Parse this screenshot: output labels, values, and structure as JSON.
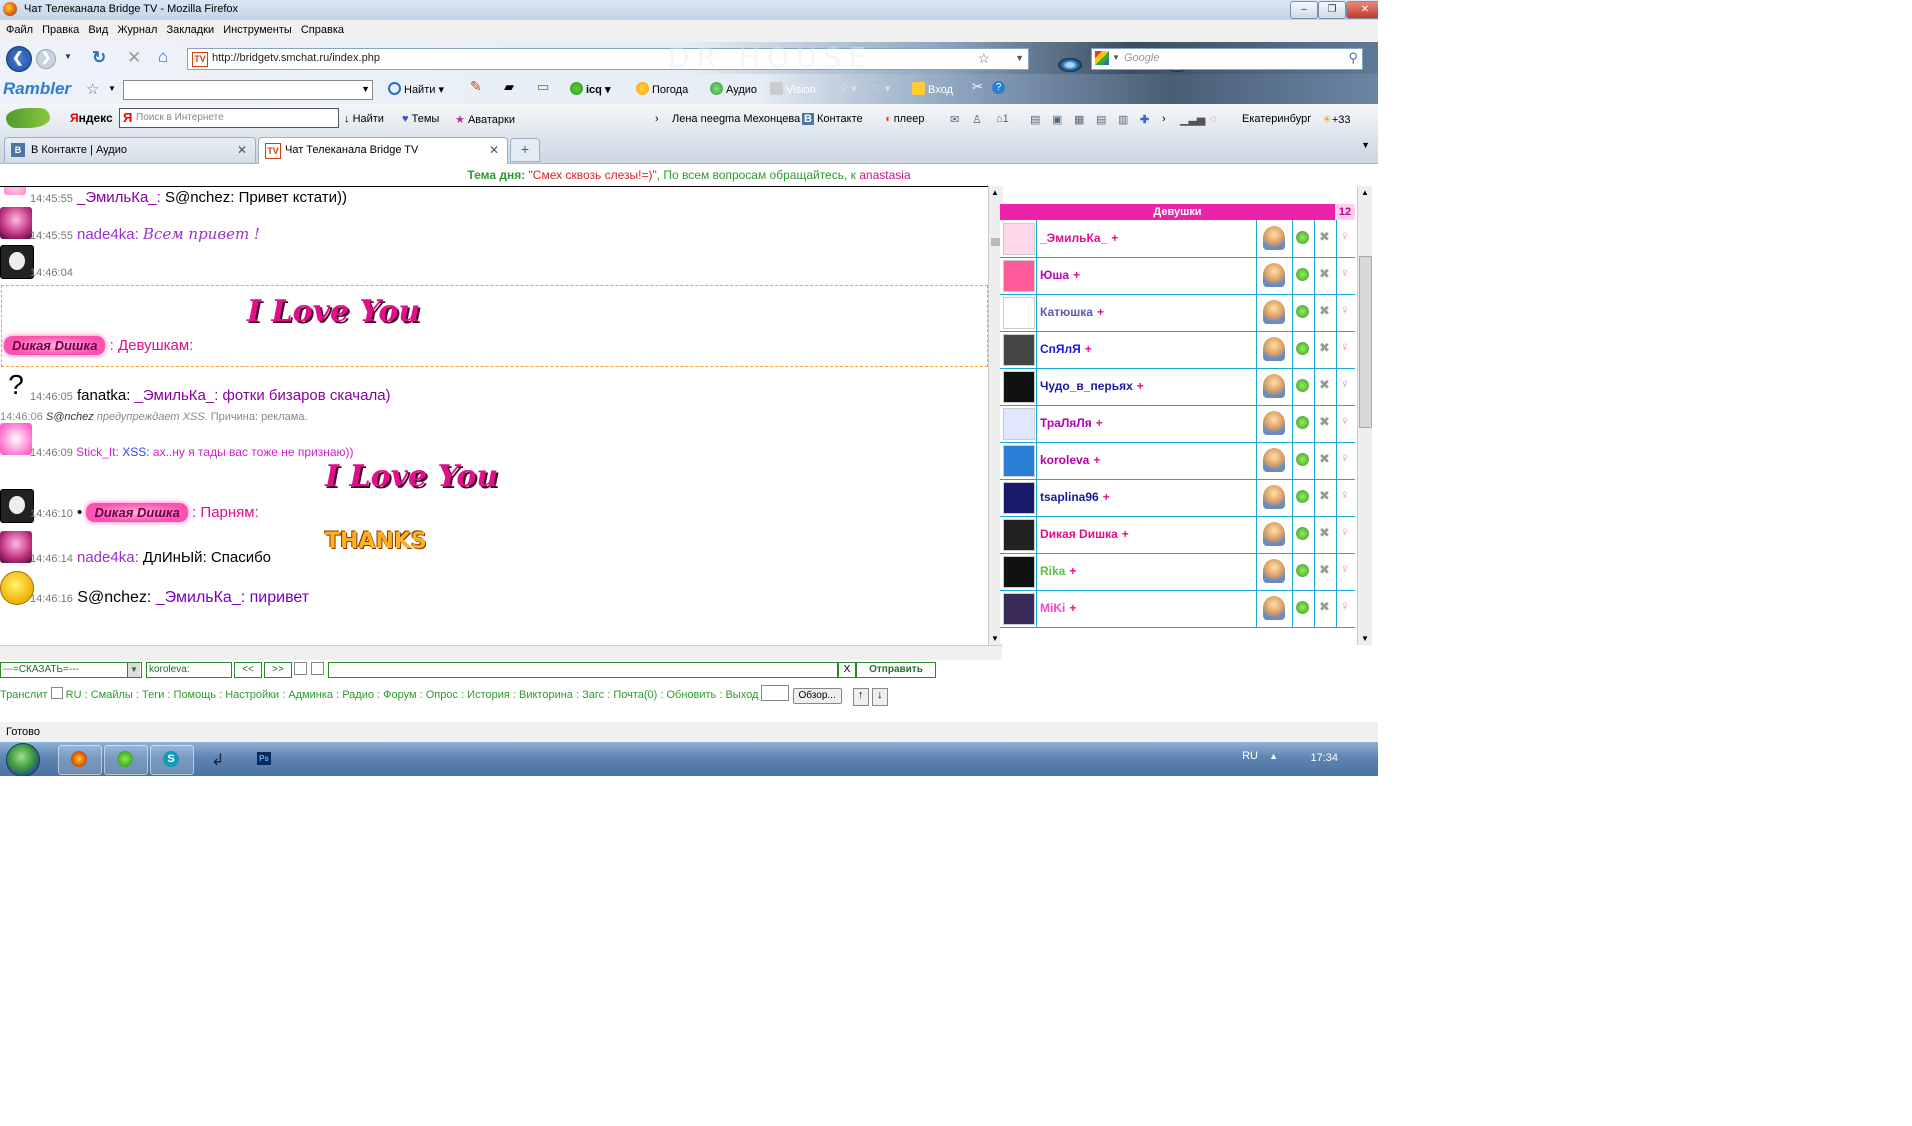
{
  "window": {
    "title": "Чат Телеканала Bridge TV - Mozilla Firefox"
  },
  "menu": [
    "Файл",
    "Правка",
    "Вид",
    "Журнал",
    "Закладки",
    "Инструменты",
    "Справка"
  ],
  "nav": {
    "url": "http://bridgetv.smchat.ru/index.php",
    "search_placeholder": "Google",
    "banner_text": "DR HOUSE"
  },
  "rambler_toolbar": {
    "logo": "Rambler",
    "find": "Найти",
    "icq": "icq",
    "weather": "Погода",
    "audio": "Аудио",
    "vision": "Vision",
    "login": "Вход"
  },
  "yandex_toolbar": {
    "logo_y": "Я",
    "logo_rest": "ндекс",
    "search_ya": "Я",
    "search_placeholder": "Поиск в Интернете",
    "find": "Найти",
    "themes": "Темы",
    "avatars": "Аватарки",
    "bookmark": "Лена neegma Мехонцева",
    "vk": "Контакте",
    "player": "плеер",
    "mail_count": "1",
    "city": "Екатеринбург",
    "temp": "+33"
  },
  "tabs": [
    {
      "label": "В Контакте | Аудио",
      "active": false
    },
    {
      "label": "Чат Телеканала Bridge TV",
      "active": true
    }
  ],
  "topic": {
    "label": "Тема дня:",
    "text": "\"Смех сквозь слезы!=)\"",
    "rest": ", По всем вопросам обращайтесь, к",
    "user": "anastasia"
  },
  "messages": {
    "m1": {
      "time": "14:45:55",
      "from": "_ЭмильКа_",
      "to": "S@nchez",
      "text": "Привет кстати))"
    },
    "m2": {
      "time": "14:45:55",
      "from": "nade4ka",
      "text": "Всем привет !"
    },
    "m3": {
      "time": "14:46:04"
    },
    "m4": {
      "from": "Dикая Dишка",
      "to": "Девушкам:",
      "image_text": "I Love You"
    },
    "m5": {
      "time": "14:46:05",
      "from": "fanatka",
      "to": "_ЭмильКа_",
      "text": "фотки бизаров скачала)"
    },
    "m6": {
      "time": "14:46:06",
      "from": "S@nchez",
      "action": "предупреждает XSS.",
      "reason": "Причина: реклама."
    },
    "m7": {
      "time": "14:46:09",
      "from": "Stick_It",
      "to": "XSS",
      "text": "ах..ну я тады вас тоже не признаю))"
    },
    "m8": {
      "time": "14:46:10",
      "bullet": "•",
      "from": "Dикая Dишка",
      "to": "Парням:",
      "image_text": "I Love You"
    },
    "m9": {
      "time": "14:46:14",
      "from": "nade4ka",
      "to": "ДлИнЫй",
      "text": "Спасибо",
      "image_text": "THANKS"
    },
    "m10": {
      "time": "14:46:16",
      "from": "S@nchez",
      "to": "_ЭмильКа_",
      "text": "пиривет"
    }
  },
  "users": {
    "header": "Девушки",
    "count": "12",
    "list": [
      {
        "name": "_ЭмильКа_",
        "color": "#e0108a"
      },
      {
        "name": "Юша",
        "color": "#c000c0"
      },
      {
        "name": "Катюшка",
        "color": "#5a5ab0"
      },
      {
        "name": "СпЯлЯ",
        "color": "#1a1ae0"
      },
      {
        "name": "Чудо_в_перьях",
        "color": "#1a1a9a"
      },
      {
        "name": "ТраЛяЛя",
        "color": "#b000b0"
      },
      {
        "name": "koroleva",
        "color": "#b000b0"
      },
      {
        "name": "tsaplina96",
        "color": "#1a1a9a"
      },
      {
        "name": "Dикая Dишка",
        "color": "#e0108a"
      },
      {
        "name": "Rika",
        "color": "#5ac040"
      },
      {
        "name": "MiKi",
        "color": "#ff40d0"
      }
    ]
  },
  "controls": {
    "say": "---=СКАЗАТЬ=---",
    "recipient": "koroleva:",
    "prev": "<<",
    "next": ">>",
    "clear": "X",
    "send": "Отправить",
    "browse": "Обзор..."
  },
  "links": [
    "Транслит",
    "RU",
    "Смайлы",
    "Теги",
    "Помощь",
    "Настройки",
    "Админка",
    "Радио",
    "Форум",
    "Опрос",
    "История",
    "Викторина",
    "Загс",
    "Почта(0)",
    "Обновить",
    "Выход"
  ],
  "status": "Готово",
  "taskbar": {
    "lang": "RU",
    "clock": "17:34"
  }
}
